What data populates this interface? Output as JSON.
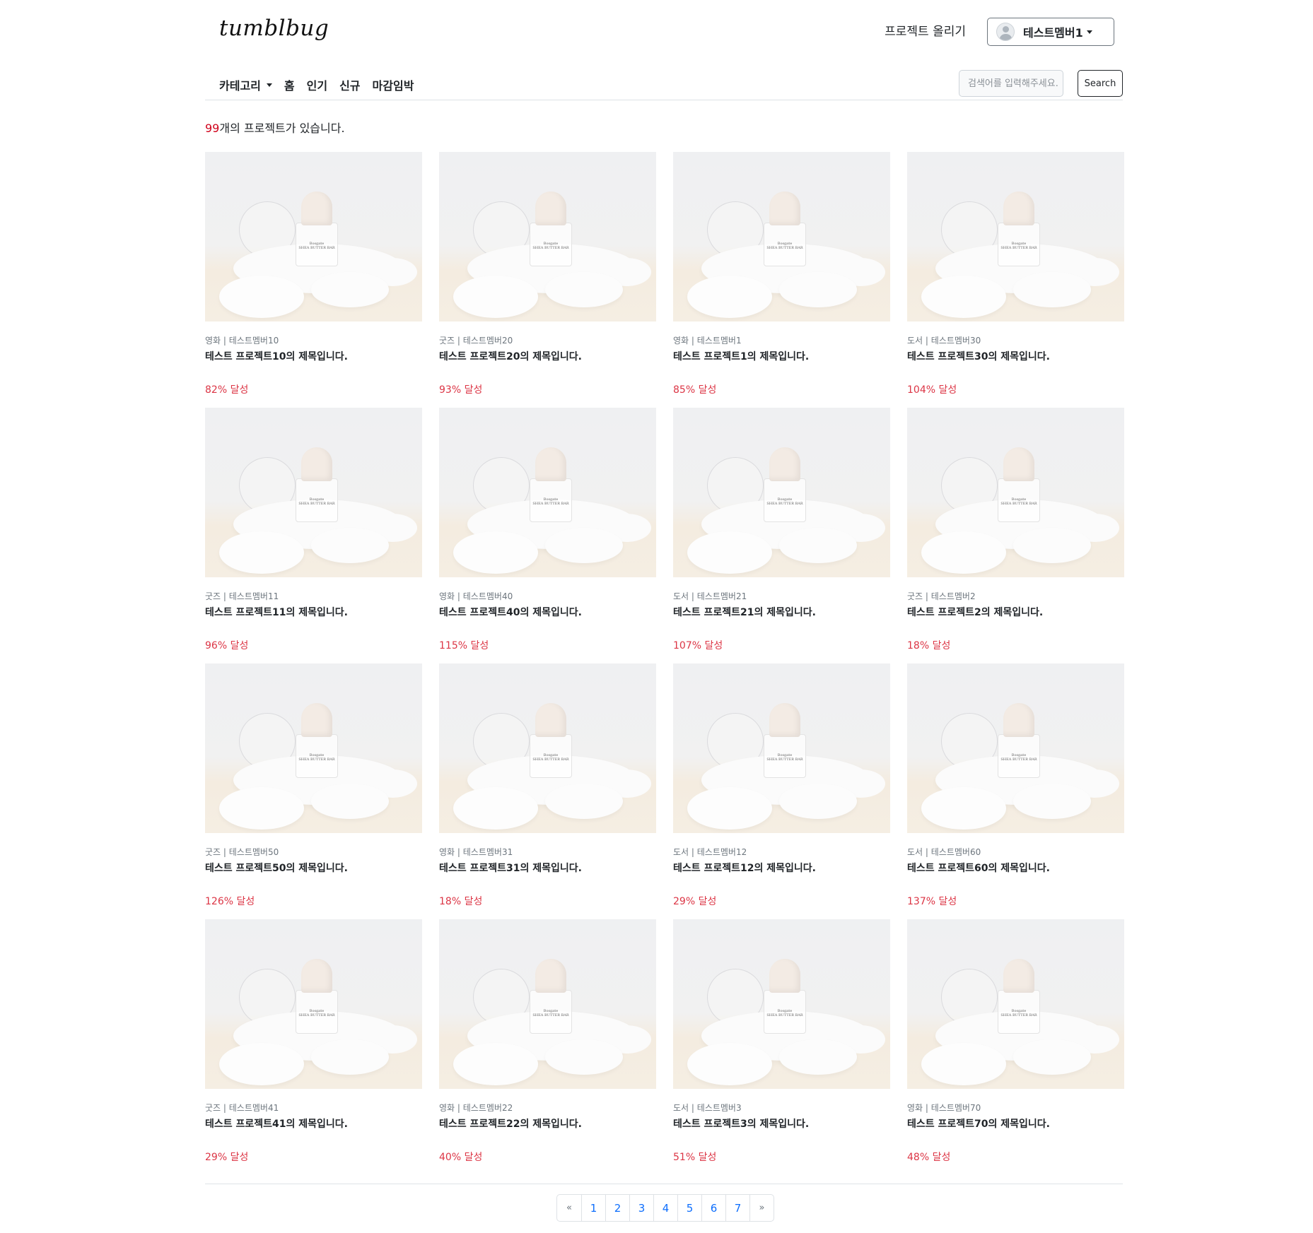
{
  "header": {
    "logo": "tumblbug",
    "upload_label": "프로젝트 올리기",
    "user_name": "테스트멤버1"
  },
  "nav": {
    "items": [
      "카테고리",
      "홈",
      "인기",
      "신규",
      "마감임박"
    ],
    "search_placeholder": "검색어를 입력해주세요.",
    "search_button": "Search"
  },
  "summary": {
    "count": "99",
    "suffix": "개의 프로젝트가 있습니다."
  },
  "thumbnail": {
    "brand": "Bosgate",
    "product": "SHEA BUTTER BAR"
  },
  "projects": [
    {
      "meta": "영화 | 테스트멤버10",
      "title": "테스트 프로젝트10의 제목입니다.",
      "percent": "82% 달성"
    },
    {
      "meta": "굿즈 | 테스트멤버20",
      "title": "테스트 프로젝트20의 제목입니다.",
      "percent": "93% 달성"
    },
    {
      "meta": "영화 | 테스트멤버1",
      "title": "테스트 프로젝트1의 제목입니다.",
      "percent": "85% 달성"
    },
    {
      "meta": "도서 | 테스트멤버30",
      "title": "테스트 프로젝트30의 제목입니다.",
      "percent": "104% 달성"
    },
    {
      "meta": "굿즈 | 테스트멤버11",
      "title": "테스트 프로젝트11의 제목입니다.",
      "percent": "96% 달성"
    },
    {
      "meta": "영화 | 테스트멤버40",
      "title": "테스트 프로젝트40의 제목입니다.",
      "percent": "115% 달성"
    },
    {
      "meta": "도서 | 테스트멤버21",
      "title": "테스트 프로젝트21의 제목입니다.",
      "percent": "107% 달성"
    },
    {
      "meta": "굿즈 | 테스트멤버2",
      "title": "테스트 프로젝트2의 제목입니다.",
      "percent": "18% 달성"
    },
    {
      "meta": "굿즈 | 테스트멤버50",
      "title": "테스트 프로젝트50의 제목입니다.",
      "percent": "126% 달성"
    },
    {
      "meta": "영화 | 테스트멤버31",
      "title": "테스트 프로젝트31의 제목입니다.",
      "percent": "18% 달성"
    },
    {
      "meta": "도서 | 테스트멤버12",
      "title": "테스트 프로젝트12의 제목입니다.",
      "percent": "29% 달성"
    },
    {
      "meta": "도서 | 테스트멤버60",
      "title": "테스트 프로젝트60의 제목입니다.",
      "percent": "137% 달성"
    },
    {
      "meta": "굿즈 | 테스트멤버41",
      "title": "테스트 프로젝트41의 제목입니다.",
      "percent": "29% 달성"
    },
    {
      "meta": "영화 | 테스트멤버22",
      "title": "테스트 프로젝트22의 제목입니다.",
      "percent": "40% 달성"
    },
    {
      "meta": "도서 | 테스트멤버3",
      "title": "테스트 프로젝트3의 제목입니다.",
      "percent": "51% 달성"
    },
    {
      "meta": "영화 | 테스트멤버70",
      "title": "테스트 프로젝트70의 제목입니다.",
      "percent": "48% 달성"
    }
  ],
  "pagination": {
    "prev": "«",
    "pages": [
      "1",
      "2",
      "3",
      "4",
      "5",
      "6",
      "7"
    ],
    "next": "»"
  },
  "colors": {
    "accent_red": "#dc3545",
    "link_blue": "#0d6efd"
  }
}
